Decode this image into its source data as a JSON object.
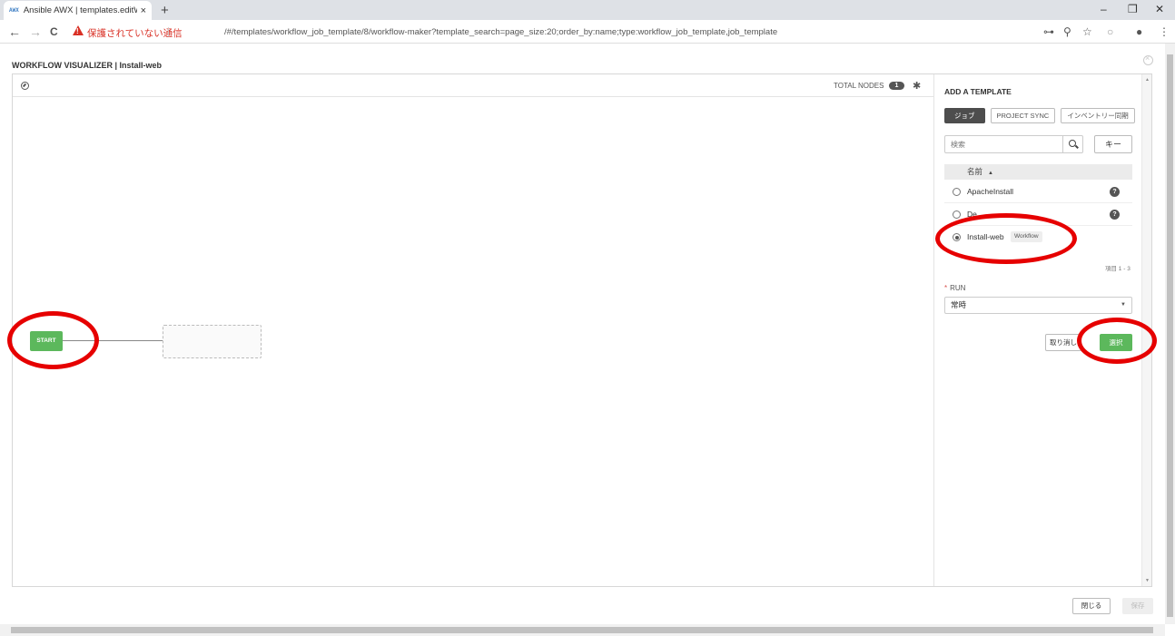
{
  "browser": {
    "tab_favicon": "AWX",
    "tab_title": "Ansible AWX | templates.editWo",
    "tab_close": "×",
    "new_tab": "+",
    "back": "←",
    "forward": "→",
    "reload": "C",
    "security_warning": "保護されていない通信",
    "url": "/#/templates/workflow_job_template/8/workflow-maker?template_search=page_size:20;order_by:name;type:workflow_job_template,job_template",
    "window_minimize": "–",
    "window_restore": "❐",
    "window_close": "✕"
  },
  "page": {
    "title": "WORKFLOW VISUALIZER | Install-web"
  },
  "canvas": {
    "total_nodes_label": "TOTAL NODES",
    "total_nodes_count": "1",
    "start_label": "START"
  },
  "sidebar": {
    "title": "ADD A TEMPLATE",
    "tabs": [
      {
        "label": "ジョブ",
        "active": true
      },
      {
        "label": "PROJECT SYNC",
        "active": false
      },
      {
        "label": "インベントリー同期",
        "active": false
      }
    ],
    "search_placeholder": "検索",
    "key_button": "キー",
    "list_header": "名前",
    "sort_indicator": "▲",
    "rows": [
      {
        "label": "ApacheInstall",
        "selected": false
      },
      {
        "label": "De",
        "selected": false
      },
      {
        "label": "Install-web",
        "selected": true,
        "badge": "Workflow"
      }
    ],
    "pager": "項目 1 - 3",
    "run_label": "RUN",
    "run_required": "*",
    "run_value": "常時",
    "cancel_button": "取り消し",
    "select_button": "選択"
  },
  "footer": {
    "close_button": "閉じる",
    "save_button": "保存"
  },
  "colors": {
    "start_node": "#5cb85c",
    "select_button": "#5cb85c",
    "highlight": "#e60000",
    "active_tab": "#4d4d4d"
  }
}
